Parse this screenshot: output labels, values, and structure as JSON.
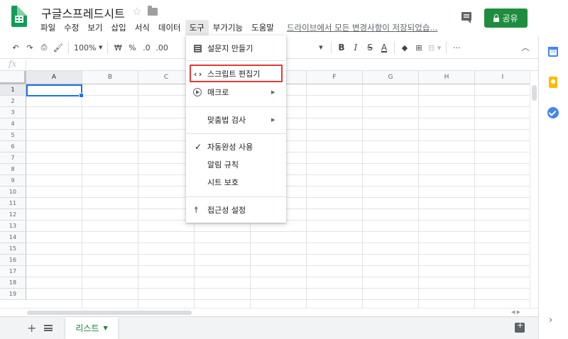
{
  "app": {
    "title": "구글스프레드시트",
    "save_status": "드라이브에서 모든 변경사항이 저장되었습...",
    "share_label": "공유"
  },
  "menus": [
    "파일",
    "수정",
    "보기",
    "삽입",
    "서식",
    "데이터",
    "도구",
    "부가기능",
    "도움말"
  ],
  "active_menu": "도구",
  "toolbar": {
    "zoom": "100%",
    "currency": "₩",
    "percent": "%",
    "dec_decrease": ".0",
    "dec_increase": ".00",
    "bold": "B",
    "italic": "I",
    "strike": "S",
    "text_color": "A",
    "more": "···"
  },
  "formula_bar": {
    "label": "fx",
    "value": ""
  },
  "columns": [
    "A",
    "B",
    "C",
    "D",
    "E",
    "F",
    "G",
    "H",
    "I"
  ],
  "rows": [
    "1",
    "2",
    "3",
    "4",
    "5",
    "6",
    "7",
    "8",
    "9",
    "10",
    "11",
    "12",
    "13",
    "14",
    "15",
    "16",
    "17",
    "18",
    "19"
  ],
  "selected_cell": "A1",
  "sheet_tabs": [
    {
      "label": "리스트",
      "active": true
    }
  ],
  "dropdown": {
    "items": [
      {
        "label": "설문지 만들기",
        "icon": "form-icon",
        "submenu": false
      },
      {
        "label": "스크립트 편집기",
        "icon": "code-icon",
        "submenu": false,
        "highlighted": true
      },
      {
        "label": "매크로",
        "icon": "play-circle-icon",
        "submenu": true
      },
      {
        "label": "맞춤법 검사",
        "icon": "",
        "submenu": true
      },
      {
        "label": "자동완성 사용",
        "icon": "check-icon",
        "submenu": false,
        "checked": true
      },
      {
        "label": "알림 규칙",
        "icon": "",
        "submenu": false
      },
      {
        "label": "시트 보호",
        "icon": "",
        "submenu": false
      },
      {
        "label": "접근성 설정",
        "icon": "accessibility-icon",
        "submenu": false
      }
    ],
    "submenu_arrow": "▶"
  },
  "side_panel": {
    "calendar_day": "31"
  },
  "colors": {
    "brand_green": "#0f9d58",
    "share_green": "#1e8e3e",
    "selection_blue": "#1a73e8",
    "highlight_red": "#e53935",
    "tab_text_green": "#188038"
  }
}
